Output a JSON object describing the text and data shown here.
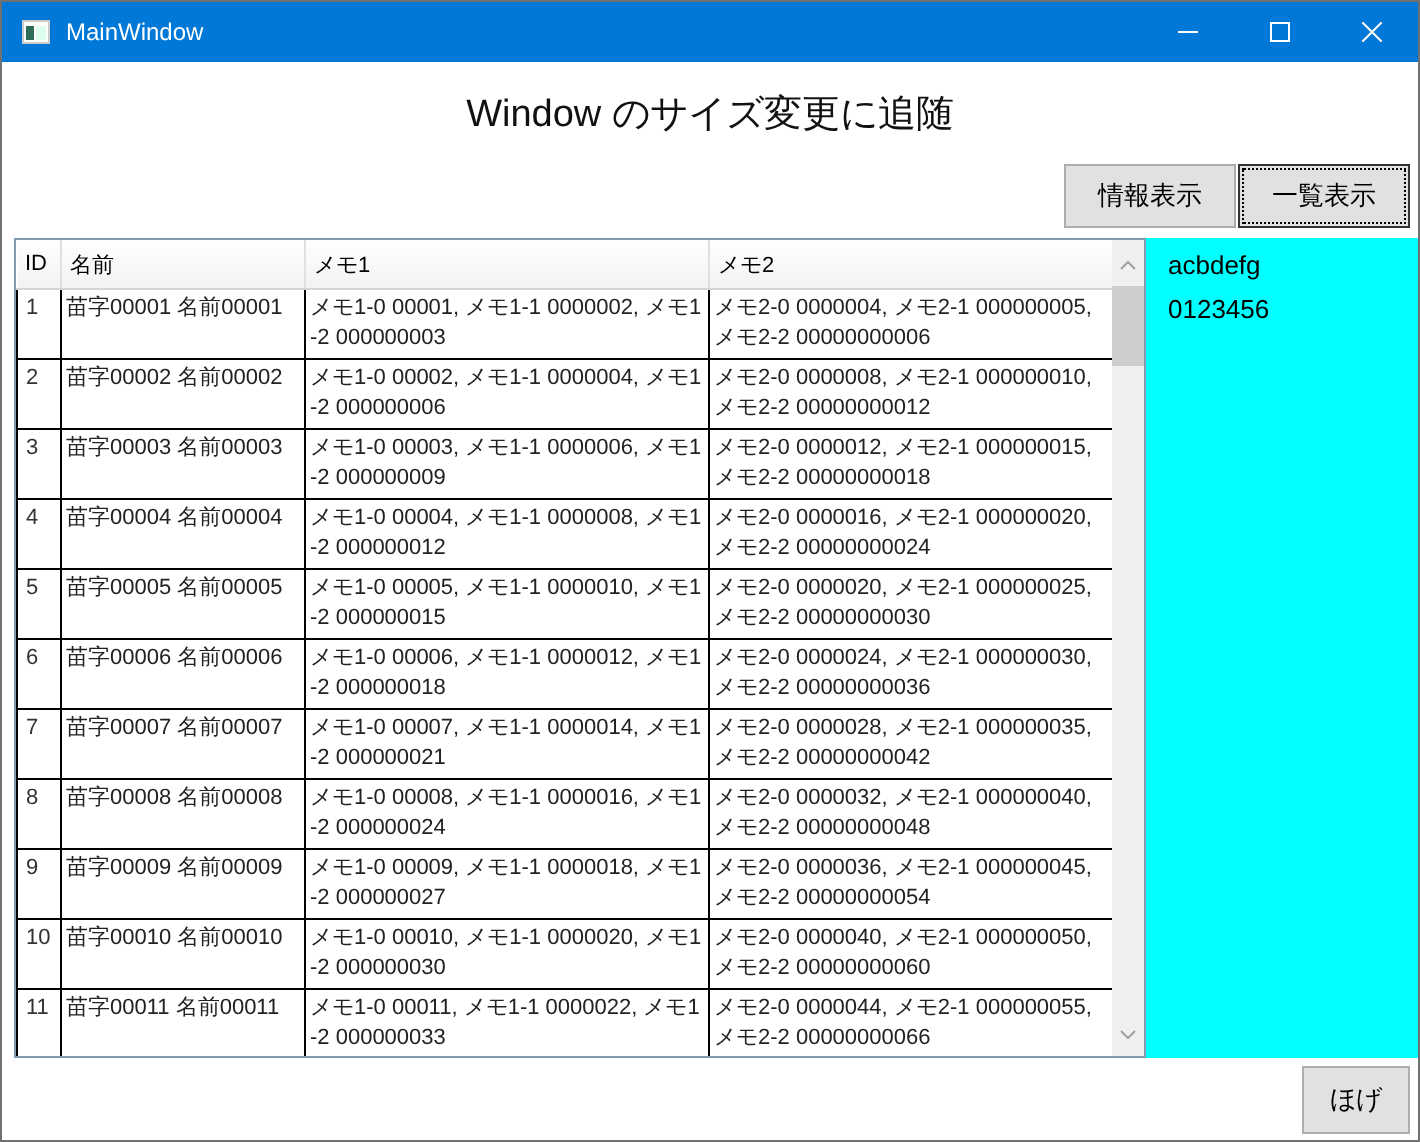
{
  "window": {
    "title": "MainWindow"
  },
  "heading": "Window のサイズ変更に追随",
  "buttons": [
    {
      "label": "情報表示",
      "focused": false
    },
    {
      "label": "一覧表示",
      "focused": true
    }
  ],
  "table": {
    "columns": [
      "ID",
      "名前",
      "メモ1",
      "メモ2"
    ],
    "rows": [
      {
        "id": "1",
        "name": "苗字00001 名前00001",
        "memo1": "メモ1-0 00001, メモ1-1 0000002, メモ1-2 000000003",
        "memo2": "メモ2-0 0000004, メモ2-1 000000005, メモ2-2 00000000006"
      },
      {
        "id": "2",
        "name": "苗字00002 名前00002",
        "memo1": "メモ1-0 00002, メモ1-1 0000004, メモ1-2 000000006",
        "memo2": "メモ2-0 0000008, メモ2-1 000000010, メモ2-2 00000000012"
      },
      {
        "id": "3",
        "name": "苗字00003 名前00003",
        "memo1": "メモ1-0 00003, メモ1-1 0000006, メモ1-2 000000009",
        "memo2": "メモ2-0 0000012, メモ2-1 000000015, メモ2-2 00000000018"
      },
      {
        "id": "4",
        "name": "苗字00004 名前00004",
        "memo1": "メモ1-0 00004, メモ1-1 0000008, メモ1-2 000000012",
        "memo2": "メモ2-0 0000016, メモ2-1 000000020, メモ2-2 00000000024"
      },
      {
        "id": "5",
        "name": "苗字00005 名前00005",
        "memo1": "メモ1-0 00005, メモ1-1 0000010, メモ1-2 000000015",
        "memo2": "メモ2-0 0000020, メモ2-1 000000025, メモ2-2 00000000030"
      },
      {
        "id": "6",
        "name": "苗字00006 名前00006",
        "memo1": "メモ1-0 00006, メモ1-1 0000012, メモ1-2 000000018",
        "memo2": "メモ2-0 0000024, メモ2-1 000000030, メモ2-2 00000000036"
      },
      {
        "id": "7",
        "name": "苗字00007 名前00007",
        "memo1": "メモ1-0 00007, メモ1-1 0000014, メモ1-2 000000021",
        "memo2": "メモ2-0 0000028, メモ2-1 000000035, メモ2-2 00000000042"
      },
      {
        "id": "8",
        "name": "苗字00008 名前00008",
        "memo1": "メモ1-0 00008, メモ1-1 0000016, メモ1-2 000000024",
        "memo2": "メモ2-0 0000032, メモ2-1 000000040, メモ2-2 00000000048"
      },
      {
        "id": "9",
        "name": "苗字00009 名前00009",
        "memo1": "メモ1-0 00009, メモ1-1 0000018, メモ1-2 000000027",
        "memo2": "メモ2-0 0000036, メモ2-1 000000045, メモ2-2 00000000054"
      },
      {
        "id": "10",
        "name": "苗字00010 名前00010",
        "memo1": "メモ1-0 00010, メモ1-1 0000020, メモ1-2 000000030",
        "memo2": "メモ2-0 0000040, メモ2-1 000000050, メモ2-2 00000000060"
      },
      {
        "id": "11",
        "name": "苗字00011 名前00011",
        "memo1": "メモ1-0 00011, メモ1-1 0000022, メモ1-2 000000033",
        "memo2": "メモ2-0 0000044, メモ2-1 000000055, メモ2-2 00000000066"
      }
    ]
  },
  "side_panel": {
    "lines": [
      "acbdefg",
      "0123456"
    ]
  },
  "bottom_button": {
    "label": "ほげ"
  }
}
